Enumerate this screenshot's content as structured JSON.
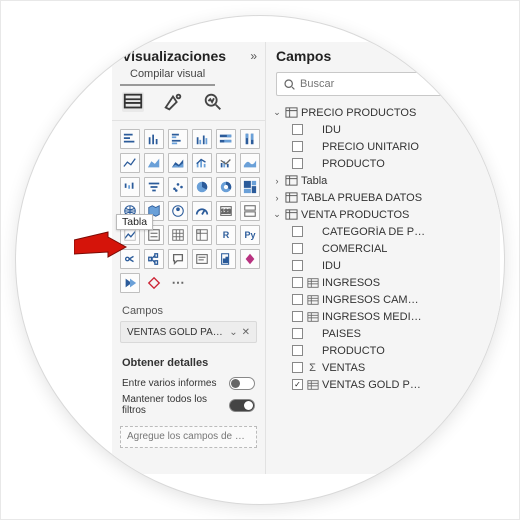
{
  "viz_pane": {
    "title": "Visualizaciones",
    "collapse": "»",
    "subtitle": "Compilar visual",
    "tooltip": "Tabla",
    "fields_label": "Campos",
    "well_field": "VENTAS GOLD PAULA",
    "details_title": "Obtener detalles",
    "toggle_cross": "Entre varios informes",
    "toggle_keep": "Mantener todos los filtros",
    "drill_placeholder": "Agregue los campos de ob…"
  },
  "fields_pane": {
    "title": "Campos",
    "collapse": "»",
    "search_placeholder": "Buscar",
    "tables": [
      {
        "name": "PRECIO PRODUCTOS",
        "expanded": true,
        "fields": [
          {
            "name": "IDU",
            "checked": false,
            "icon": ""
          },
          {
            "name": "PRECIO UNITARIO",
            "checked": false,
            "icon": ""
          },
          {
            "name": "PRODUCTO",
            "checked": false,
            "icon": ""
          }
        ]
      },
      {
        "name": "Tabla",
        "expanded": false,
        "fields": []
      },
      {
        "name": "TABLA PRUEBA DATOS",
        "expanded": false,
        "fields": []
      },
      {
        "name": "VENTA PRODUCTOS",
        "expanded": true,
        "fields": [
          {
            "name": "CATEGORÍA DE P…",
            "checked": false,
            "icon": ""
          },
          {
            "name": "COMERCIAL",
            "checked": false,
            "icon": ""
          },
          {
            "name": "IDU",
            "checked": false,
            "icon": ""
          },
          {
            "name": "INGRESOS",
            "checked": false,
            "icon": "table"
          },
          {
            "name": "INGRESOS CAM…",
            "checked": false,
            "icon": "table"
          },
          {
            "name": "INGRESOS MEDI…",
            "checked": false,
            "icon": "table"
          },
          {
            "name": "PAISES",
            "checked": false,
            "icon": ""
          },
          {
            "name": "PRODUCTO",
            "checked": false,
            "icon": ""
          },
          {
            "name": "VENTAS",
            "checked": false,
            "icon": "sum"
          },
          {
            "name": "VENTAS GOLD P…",
            "checked": true,
            "icon": "table"
          }
        ]
      }
    ]
  }
}
